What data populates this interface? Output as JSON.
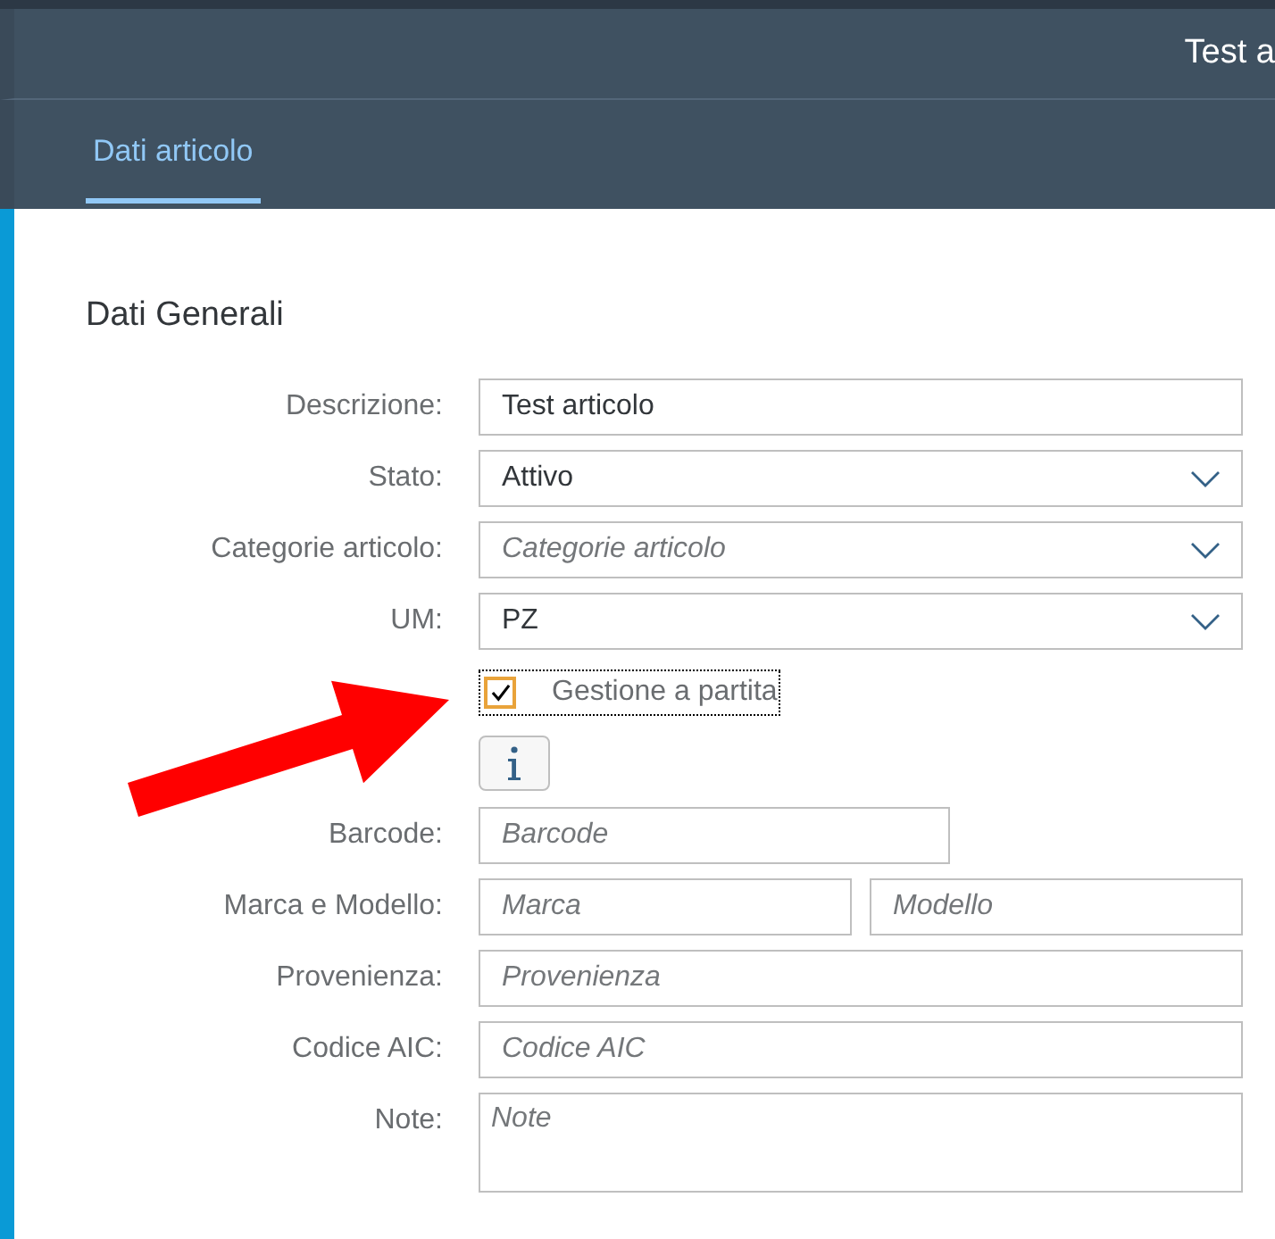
{
  "header": {
    "title": "Test a"
  },
  "tabs": [
    {
      "label": "Dati articolo",
      "selected": true
    }
  ],
  "section": {
    "title": "Dati Generali"
  },
  "form": {
    "rows": [
      {
        "kind": "text",
        "label": "Descrizione:",
        "fields": [
          {
            "value": "Test articolo"
          }
        ]
      },
      {
        "kind": "select",
        "label": "Stato:",
        "fields": [
          {
            "value": "Attivo"
          }
        ]
      },
      {
        "kind": "select",
        "label": "Categorie articolo:",
        "fields": [
          {
            "placeholder": "Categorie articolo"
          }
        ]
      },
      {
        "kind": "select",
        "label": "UM:",
        "fields": [
          {
            "value": "PZ"
          }
        ]
      },
      {
        "kind": "checkbox",
        "text": "Gestione a partita",
        "checked": true,
        "focused": true
      },
      {
        "kind": "info"
      },
      {
        "kind": "narrow",
        "label": "Barcode:",
        "fields": [
          {
            "placeholder": "Barcode"
          }
        ]
      },
      {
        "kind": "text",
        "label": "Marca e Modello:",
        "fields": [
          {
            "placeholder": "Marca"
          },
          {
            "placeholder": "Modello"
          }
        ]
      },
      {
        "kind": "text",
        "label": "Provenienza:",
        "fields": [
          {
            "placeholder": "Provenienza"
          }
        ]
      },
      {
        "kind": "text",
        "label": "Codice AIC:",
        "fields": [
          {
            "placeholder": "Codice AIC"
          }
        ]
      },
      {
        "kind": "textarea",
        "label": "Note:",
        "fields": [
          {
            "placeholder": "Note"
          }
        ]
      }
    ]
  }
}
